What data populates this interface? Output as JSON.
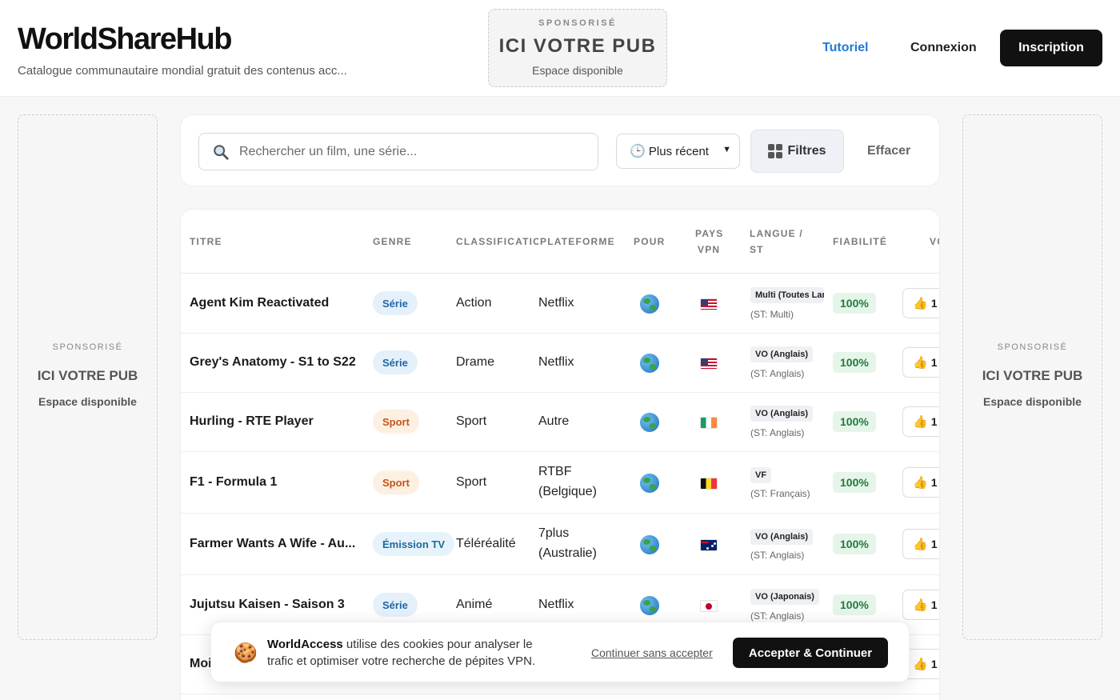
{
  "header": {
    "brand": "WorldShareHub",
    "tagline": "Catalogue communautaire mondial gratuit des contenus acc...",
    "ad": {
      "sponsored": "SPONSORISÉ",
      "title": "ICI VOTRE PUB",
      "subtitle": "Espace disponible"
    },
    "nav": {
      "tutorial": "Tutoriel",
      "login": "Connexion",
      "signup": "Inscription"
    }
  },
  "side_ads": {
    "left": {
      "sponsored": "SPONSORISÉ",
      "title": "ICI VOTRE PUB",
      "subtitle": "Espace disponible"
    },
    "right": {
      "sponsored": "SPONSORISÉ",
      "title": "ICI VOTRE PUB",
      "subtitle": "Espace disponible"
    }
  },
  "search": {
    "placeholder": "Rechercher un film, une série...",
    "sort_label": "Plus récent",
    "filters_label": "Filtres",
    "clear_label": "Effacer"
  },
  "table": {
    "headers": {
      "title": "TITRE",
      "genre": "GENRE",
      "classification": "CLASSIFICATION",
      "platform": "PLATEFORME",
      "for": "POUR",
      "vpn_country_1": "PAYS",
      "vpn_country_2": "VPN",
      "lang_1": "LANGUE /",
      "lang_2": "ST",
      "reliability": "FIABILITÉ",
      "votes": "VOTES"
    },
    "rows": [
      {
        "title": "Agent Kim Reactivated",
        "genre": "Série",
        "genre_kind": "serie",
        "classification": "Action",
        "platform_1": "Netflix",
        "platform_2": "",
        "flag": "us",
        "lang": "Multi (Toutes Langues)",
        "st": "(ST: Multi)",
        "reliability": "100%",
        "votes": "1"
      },
      {
        "title": "Grey's Anatomy - S1 to S22",
        "genre": "Série",
        "genre_kind": "serie",
        "classification": "Drame",
        "platform_1": "Netflix",
        "platform_2": "",
        "flag": "us",
        "lang": "VO (Anglais)",
        "st": "(ST: Anglais)",
        "reliability": "100%",
        "votes": "1"
      },
      {
        "title": "Hurling - RTE Player",
        "genre": "Sport",
        "genre_kind": "sport",
        "classification": "Sport",
        "platform_1": "Autre",
        "platform_2": "",
        "flag": "ie",
        "lang": "VO (Anglais)",
        "st": "(ST: Anglais)",
        "reliability": "100%",
        "votes": "1"
      },
      {
        "title": "F1 - Formula 1",
        "genre": "Sport",
        "genre_kind": "sport",
        "classification": "Sport",
        "platform_1": "RTBF",
        "platform_2": "(Belgique)",
        "flag": "be",
        "lang": "VF",
        "st": "(ST: Français)",
        "reliability": "100%",
        "votes": "1"
      },
      {
        "title": "Farmer Wants A Wife - Au...",
        "genre": "Émission TV",
        "genre_kind": "emission",
        "classification": "Téléréalité",
        "platform_1": "7plus",
        "platform_2": "(Australie)",
        "flag": "au",
        "lang": "VO (Anglais)",
        "st": "(ST: Anglais)",
        "reliability": "100%",
        "votes": "1"
      },
      {
        "title": "Jujutsu Kaisen - Saison 3",
        "genre": "Série",
        "genre_kind": "serie",
        "classification": "Animé",
        "platform_1": "Netflix",
        "platform_2": "",
        "flag": "jp",
        "lang": "VO (Japonais)",
        "st": "(ST: Anglais)",
        "reliability": "100%",
        "votes": "1"
      },
      {
        "title": "Moi",
        "genre": "",
        "genre_kind": "",
        "classification": "",
        "platform_1": "",
        "platform_2": "",
        "flag": "",
        "lang": "",
        "st": "",
        "reliability": "",
        "votes": "1"
      }
    ]
  },
  "cookie": {
    "brand": "WorldAccess",
    "message": " utilise des cookies pour analyser le trafic et optimiser votre recherche de pépites VPN.",
    "skip": "Continuer sans accepter",
    "accept": "Accepter & Continuer"
  },
  "colors": {
    "accent": "#1f7ad8",
    "primary_button": "#111111",
    "reliability_bg": "#e6f5ea",
    "reliability_text": "#217a3c"
  }
}
